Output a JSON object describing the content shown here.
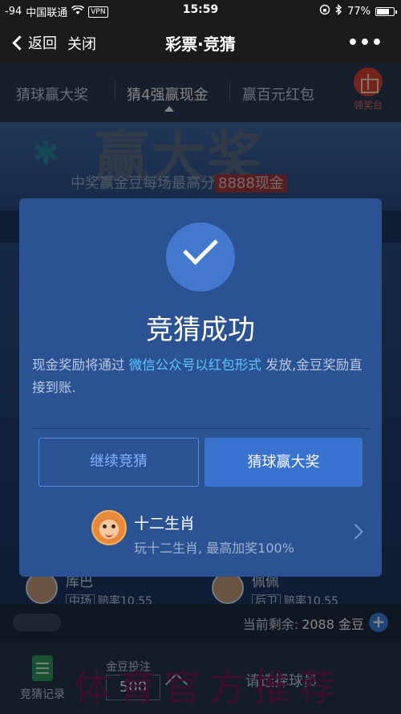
{
  "status_bar": {
    "signal": "-94",
    "carrier": "中国联通",
    "vpn": "VPN",
    "time": "15:59",
    "battery": "77%",
    "battery_level": 0.77
  },
  "nav": {
    "back_label": "返回",
    "close_label": "关闭",
    "title": "彩票·竞猜",
    "more": "•••"
  },
  "tabs": {
    "items": [
      "猜球赢大奖",
      "猜4强赢现金",
      "赢百元红包"
    ],
    "active_index": 1,
    "prize_label": "领奖台"
  },
  "banner": {
    "headline": "赢大奖",
    "subtitle": "中奖赢金豆每场最高分",
    "highlight": "8888现金"
  },
  "players": [
    {
      "name": "库巴",
      "position": "中场",
      "odds": "赔率10.55"
    },
    {
      "name": "佩佩",
      "position": "后卫",
      "odds": "赔率10.55"
    }
  ],
  "bet_bar": {
    "remaining_label": "当前剩余:",
    "remaining_value": "2088 金豆",
    "plus": "+"
  },
  "bottom_bar": {
    "records_label": "竞猜记录",
    "stake_label": "金豆投注",
    "stake_value": "500",
    "choose_player": "请选择球员",
    "watermark": "体育官方推荐"
  },
  "modal": {
    "title": "竞猜成功",
    "message_prefix": "现金奖励将通过",
    "message_highlight": "微信公众号以红包形式",
    "message_suffix": "发放,金豆奖励直接到账.",
    "continue_label": "继续竞猜",
    "big_prize_label": "猜球赢大奖",
    "promo_title": "十二生肖",
    "promo_subtitle": "玩十二生肖, 最高加奖100%"
  },
  "colors": {
    "modal_bg": "#2b5393",
    "accent": "#3a73cf",
    "highlight_text": "#5ec5ff"
  }
}
